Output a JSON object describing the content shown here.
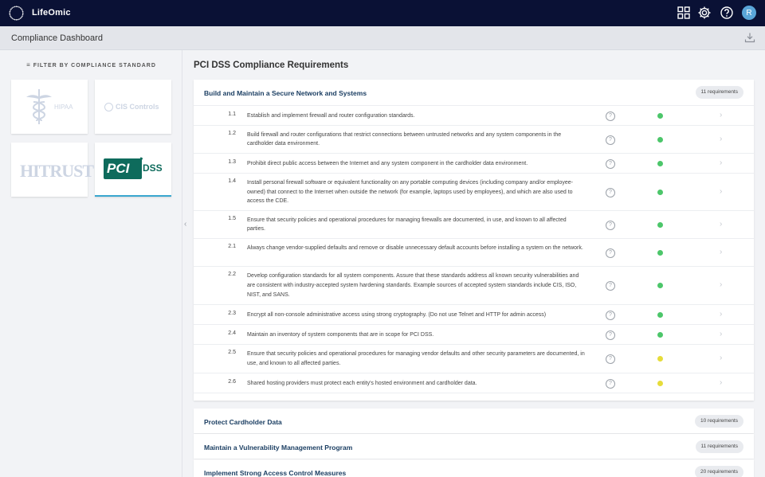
{
  "app": {
    "brand": "LifeOmic",
    "user_initial": "R"
  },
  "header": {
    "icons": [
      "apps-grid-icon",
      "gear-icon",
      "help-icon"
    ]
  },
  "page": {
    "title": "Compliance Dashboard"
  },
  "sidebar": {
    "filter_label": "FILTER BY COMPLIANCE STANDARD",
    "standards": [
      {
        "name": "HIPAA",
        "active": false
      },
      {
        "name": "CIS Controls",
        "active": false
      },
      {
        "name": "HITRUST",
        "active": false
      },
      {
        "name": "PCI DSS",
        "active": true,
        "logo_pci": "PCI",
        "logo_dss": "DSS"
      }
    ]
  },
  "main": {
    "title": "PCI DSS Compliance Requirements",
    "expanded_section": {
      "title": "Build and Maintain a Secure Network and Systems",
      "count": "11 requirements",
      "rows": [
        {
          "num": "1.1",
          "text": "Establish and implement firewall and router configuration standards.",
          "status": "green"
        },
        {
          "num": "1.2",
          "text": "Build firewall and router configurations that restrict connections between untrusted networks and any system components in the cardholder data environment.",
          "status": "green"
        },
        {
          "num": "1.3",
          "text": "Prohibit direct public access between the Internet and any system component in the cardholder data environment.",
          "status": "green"
        },
        {
          "num": "1.4",
          "text": "Install personal firewall software or equivalent functionality on any portable computing devices (including company and/or employee-owned) that connect to the Internet when outside the network (for example, laptops used by employees), and which are also used to access the CDE.",
          "status": "green"
        },
        {
          "num": "1.5",
          "text": "Ensure that security policies and operational procedures for managing firewalls are documented, in use, and known to all affected parties.",
          "status": "green"
        },
        {
          "num": "2.1",
          "text": "Always change vendor-supplied defaults and remove or disable unnecessary default accounts before installing a system on the network.",
          "status": "green"
        },
        {
          "num": "2.2",
          "text": "Develop configuration standards for all system components. Assure that these standards address all known security vulnerabilities and are consistent with industry-accepted system hardening standards. Example sources of accepted system standards include CIS, ISO, NIST, and SANS.",
          "status": "green"
        },
        {
          "num": "2.3",
          "text": "Encrypt all non-console administrative access using strong cryptography. (Do not use Telnet and HTTP for admin access)",
          "status": "green"
        },
        {
          "num": "2.4",
          "text": "Maintain an inventory of system components that are in scope for PCI DSS.",
          "status": "green"
        },
        {
          "num": "2.5",
          "text": "Ensure that security policies and operational procedures for managing vendor defaults and other security parameters are documented, in use, and known to all affected parties.",
          "status": "yellow"
        },
        {
          "num": "2.6",
          "text": "Shared hosting providers must protect each entity's hosted environment and cardholder data.",
          "status": "yellow"
        }
      ]
    },
    "collapsed_sections": [
      {
        "title": "Protect Cardholder Data",
        "count": "10 requirements"
      },
      {
        "title": "Maintain a Vulnerability Management Program",
        "count": "11 requirements"
      },
      {
        "title": "Implement Strong Access Control Measures",
        "count": "20 requirements"
      }
    ]
  },
  "colors": {
    "green": "#4cc66a",
    "yellow": "#e6dc3a",
    "nav": "#0a1135",
    "section_title": "#1c3f63"
  }
}
